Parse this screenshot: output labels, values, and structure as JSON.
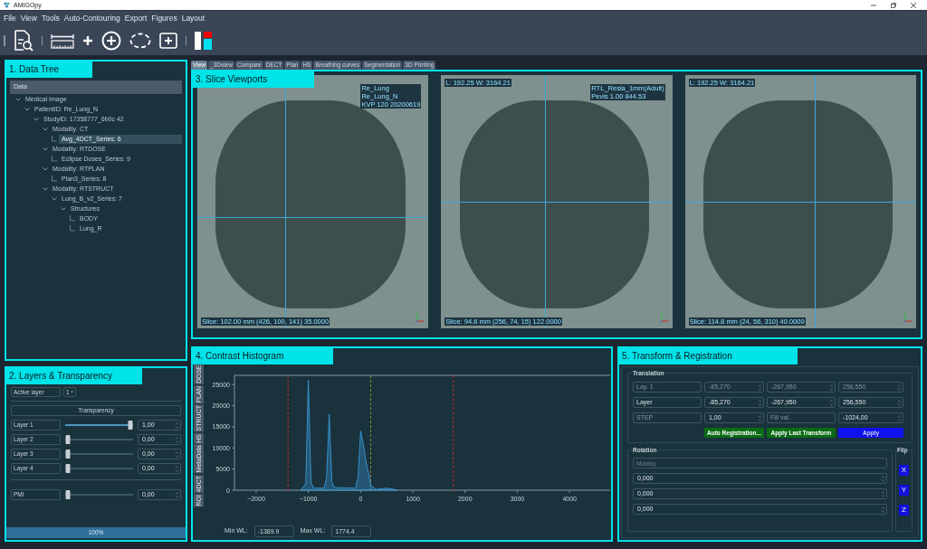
{
  "window": {
    "title": "AMIGOpy"
  },
  "menu": [
    "File",
    "View",
    "Tools",
    "Auto-Contouring",
    "Export",
    "Figures",
    "Layout"
  ],
  "tabs": [
    {
      "label": "View",
      "selected": true
    },
    {
      "label": "_3Dview",
      "selected": false
    },
    {
      "label": "Compare",
      "selected": false
    },
    {
      "label": "DECT",
      "selected": false
    },
    {
      "label": "Plan",
      "selected": false
    },
    {
      "label": "HS",
      "selected": false
    },
    {
      "label": "Breathing curves",
      "selected": false
    },
    {
      "label": "Segmentation",
      "selected": false
    },
    {
      "label": "3D Printing",
      "selected": false
    }
  ],
  "data_tree": {
    "annotation": "1. Data Tree",
    "header": "Data",
    "nodes": [
      {
        "label": "Medical Image",
        "selected": false,
        "expanded": true,
        "children": [
          {
            "label": "PatientID: Re_Lung_N",
            "selected": false,
            "expanded": true,
            "children": [
              {
                "label": "StudyID: 17358777_6b0c 42",
                "selected": false,
                "expanded": true,
                "children": [
                  {
                    "label": "Modality: CT",
                    "selected": false,
                    "expanded": true,
                    "children": [
                      {
                        "label": "Avg_4DCT_Series: 6",
                        "selected": true
                      }
                    ]
                  },
                  {
                    "label": "Modality: RTDOSE",
                    "selected": false,
                    "expanded": true,
                    "children": [
                      {
                        "label": "Eclipse Doses_Series: 9",
                        "selected": false
                      }
                    ]
                  },
                  {
                    "label": "Modality: RTPLAN",
                    "selected": false,
                    "expanded": true,
                    "children": [
                      {
                        "label": "Plan3_Series: 8",
                        "selected": false
                      }
                    ]
                  },
                  {
                    "label": "Modality: RTSTRUCT",
                    "selected": false,
                    "expanded": true,
                    "children": [
                      {
                        "label": "Lung_B_v2_Series: 7",
                        "selected": false,
                        "expanded": true,
                        "children": [
                          {
                            "label": "Structures",
                            "selected": false,
                            "expanded": true,
                            "children": [
                              {
                                "label": "BODY",
                                "selected": false
                              },
                              {
                                "label": "Lung_R",
                                "selected": false
                              }
                            ]
                          }
                        ]
                      }
                    ]
                  }
                ]
              }
            ]
          }
        ]
      }
    ]
  },
  "layers": {
    "annotation": "2. Layers & Transparency",
    "active_label": "Active layer",
    "active_value": "1",
    "transparency_header": "Transparency",
    "rows": [
      {
        "label": "Layer 1",
        "level": 1,
        "value": "1,00"
      },
      {
        "label": "Layer 2",
        "level": 0,
        "value": "0,00"
      },
      {
        "label": "Layer 3",
        "level": 0,
        "value": "0,00"
      },
      {
        "label": "Layer 4",
        "level": 0,
        "value": "0,00"
      },
      {
        "label": "PMI",
        "level": 0,
        "value": "0,00"
      }
    ],
    "progress": {
      "level": 1,
      "text": "100%"
    }
  },
  "viewports": {
    "annotation": "3. Slice Viewports",
    "views": [
      {
        "top_right": [
          "Re_Lung",
          "Re_Lung_N",
          "KVP 120 20200619"
        ],
        "slice": "Slice: 102.00 mm (426, 100, 141) 35.0000"
      },
      {
        "top_left": [
          "L: 192.25 W: 3164.21"
        ],
        "top_right": [
          "RTL_Resla_1mm(Adult)",
          "Pevis 1.00 844.53"
        ],
        "slice": "Slice: 94.6 mm (256, 74, 15) 122.0000"
      },
      {
        "top_left": [
          "L: 192.25 W: 3164.21"
        ],
        "slice": "Slice: 114.8 mm (24, 56, 310) 40.0000"
      }
    ]
  },
  "histogram": {
    "annotation": "4. Contrast Histogram",
    "side_tabs": [
      "DOSE",
      "PLAN",
      "STRUCT",
      "HS",
      "MetaData",
      "4DCT",
      "ROI"
    ],
    "chart_data": {
      "type": "area",
      "x": [
        -1150,
        -1050,
        -1000,
        -950,
        -900,
        -700,
        -650,
        -600,
        -550,
        -500,
        -100,
        -50,
        0,
        50,
        100,
        200,
        300,
        500,
        600,
        700
      ],
      "series": [
        {
          "color": "#3a9ad9",
          "values": [
            0,
            1500,
            26000,
            2000,
            500,
            500,
            3000,
            18000,
            2000,
            600,
            500,
            3000,
            14000,
            11000,
            7000,
            1000,
            200,
            500,
            300,
            0
          ]
        }
      ],
      "xlim": [
        -2415,
        4777
      ],
      "ylim": [
        0,
        27200
      ],
      "xticks": [
        {
          "value": -2000,
          "label": "−2000"
        },
        {
          "value": -1000,
          "label": "−1000"
        },
        0,
        1000,
        2000,
        3000,
        4000
      ],
      "yticks": [
        0,
        5000,
        10000,
        15000,
        20000,
        25000
      ],
      "ref_lines": [
        {
          "axis": "x",
          "value": -1389.9,
          "color": "#d42a2a"
        },
        {
          "axis": "x",
          "value": 192,
          "color": "#8a9a3a"
        },
        {
          "axis": "x",
          "value": 1774.4,
          "color": "#d42a2a"
        }
      ]
    },
    "min_label": "Min WL:",
    "min_value": "-1389.9",
    "max_label": "Max WL:",
    "max_value": "1774.4"
  },
  "transform": {
    "annotation": "5. Transform & Registration",
    "translation": {
      "title": "Translation",
      "rows": [
        [
          {
            "kind": "label",
            "text": "Lay. 1",
            "disabled": true
          },
          {
            "kind": "spin",
            "text": "-85,270",
            "disabled": true
          },
          {
            "kind": "spin",
            "text": "-267,950",
            "disabled": true
          },
          {
            "kind": "spin",
            "text": "256,550",
            "disabled": true
          }
        ],
        [
          {
            "kind": "label",
            "text": "Layer",
            "disabled": false
          },
          {
            "kind": "spin",
            "text": "-85,270",
            "disabled": false
          },
          {
            "kind": "spin",
            "text": "-267,950",
            "disabled": false
          },
          {
            "kind": "spin",
            "text": "256,550",
            "disabled": false
          }
        ],
        [
          {
            "kind": "label",
            "text": "STEP",
            "disabled": true
          },
          {
            "kind": "spin",
            "text": "1,00",
            "disabled": false
          },
          {
            "kind": "label",
            "text": "Fill val.",
            "disabled": true
          },
          {
            "kind": "spin",
            "text": "-1024,00",
            "disabled": false
          }
        ]
      ]
    },
    "buttons": [
      {
        "label": "Auto Registration...",
        "kind": "green"
      },
      {
        "label": "Apply Last Transform",
        "kind": "green"
      },
      {
        "label": "Apply",
        "kind": "blue"
      }
    ],
    "rotation": {
      "title": "Rotation",
      "placeholder": "Moving",
      "values": [
        "0,000",
        "0,000",
        "0,000"
      ]
    },
    "flip": {
      "title": "Flip",
      "buttons": [
        "X",
        "Y",
        "Z"
      ]
    }
  }
}
